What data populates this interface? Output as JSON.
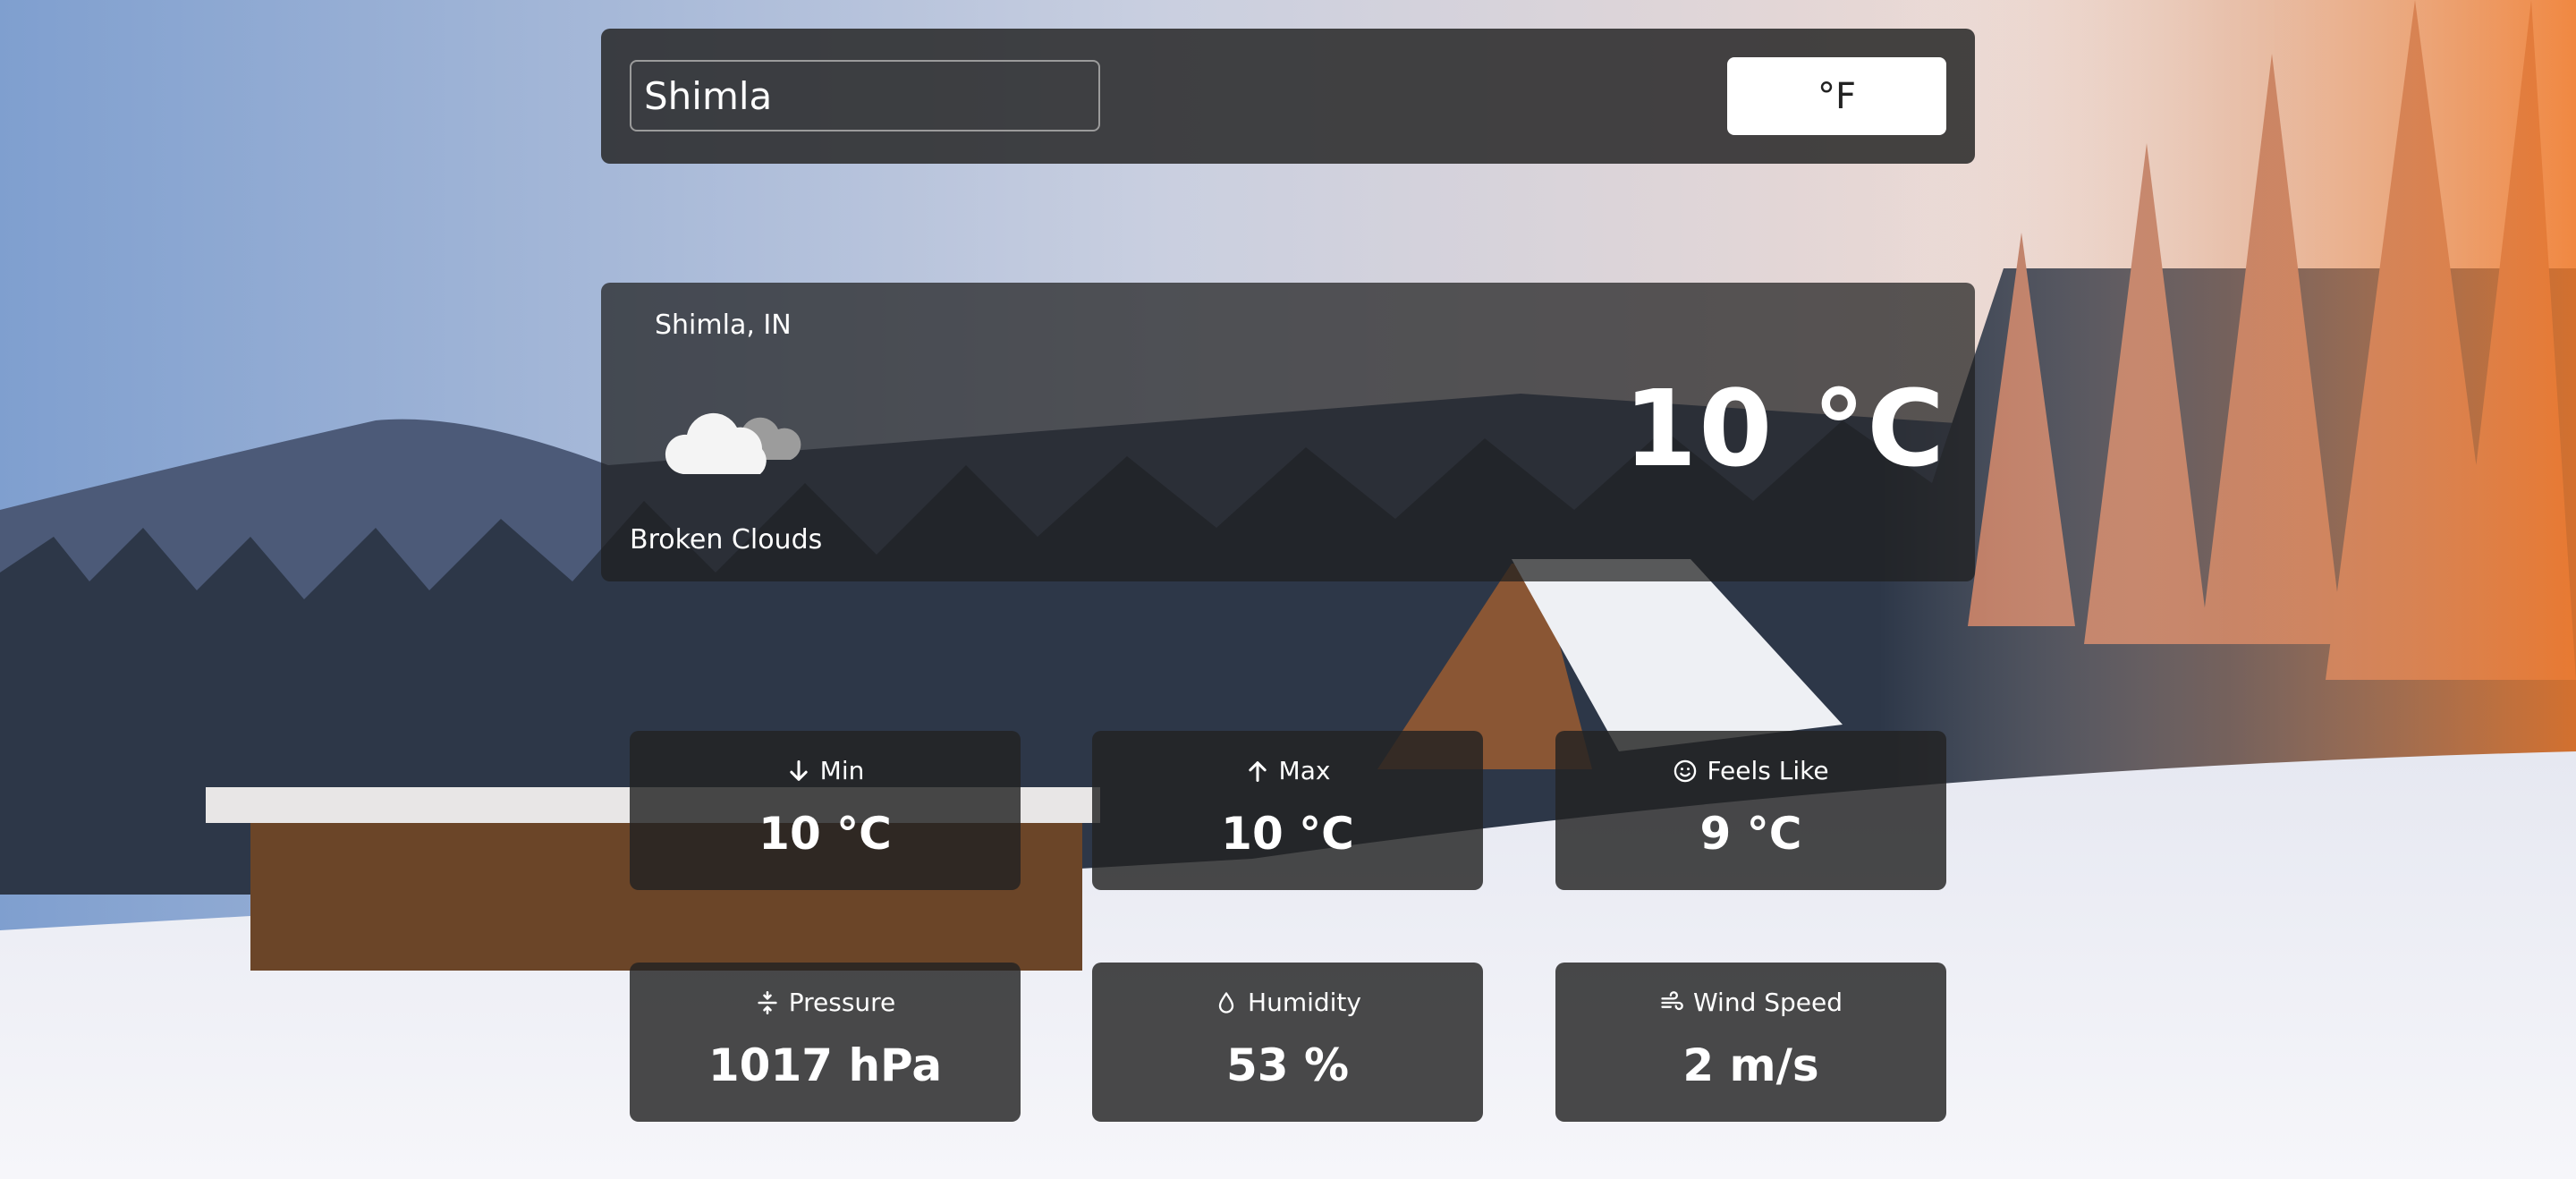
{
  "search": {
    "value": "Shimla",
    "placeholder": ""
  },
  "unit_toggle": {
    "label": "°F"
  },
  "current": {
    "location": "Shimla, IN",
    "temperature": "10 °C",
    "condition": "Broken Clouds",
    "icon": "broken-clouds-icon"
  },
  "stats": {
    "min": {
      "label": "Min",
      "value": "10 °C",
      "icon": "arrow-down-icon"
    },
    "max": {
      "label": "Max",
      "value": "10 °C",
      "icon": "arrow-up-icon"
    },
    "feels_like": {
      "label": "Feels Like",
      "value": "9 °C",
      "icon": "smile-icon"
    },
    "pressure": {
      "label": "Pressure",
      "value": "1017 hPa",
      "icon": "compress-icon"
    },
    "humidity": {
      "label": "Humidity",
      "value": "53 %",
      "icon": "droplet-icon"
    },
    "wind_speed": {
      "label": "Wind Speed",
      "value": "2 m/s",
      "icon": "wind-icon"
    }
  },
  "colors": {
    "panel": "#282828",
    "accent_text": "#ffffff",
    "button_bg": "#ffffff"
  }
}
